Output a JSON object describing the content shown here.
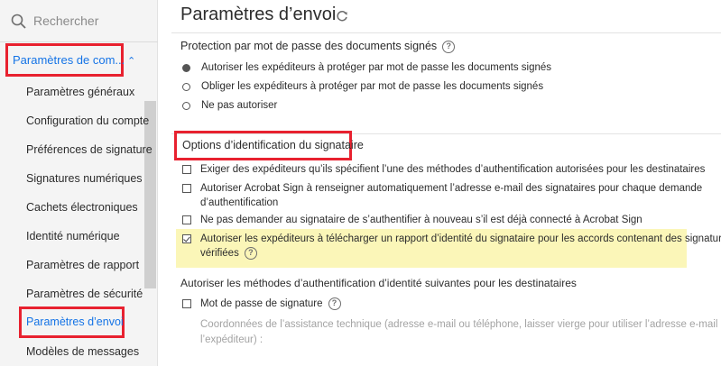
{
  "sidebar": {
    "search_placeholder": "Rechercher",
    "group_label": "Paramètres de com...",
    "items": [
      {
        "label": "Paramètres généraux"
      },
      {
        "label": "Configuration du compte"
      },
      {
        "label": "Préférences de signature"
      },
      {
        "label": "Signatures numériques"
      },
      {
        "label": "Cachets électroniques"
      },
      {
        "label": "Identité numérique"
      },
      {
        "label": "Paramètres de rapport"
      },
      {
        "label": "Paramètres de sécurité"
      },
      {
        "label": "Paramètres d’envoi"
      },
      {
        "label": "Modèles de messages"
      }
    ]
  },
  "main": {
    "title": "Paramètres d’envoi",
    "password_section": {
      "title": "Protection par mot de passe des documents signés",
      "options": [
        {
          "label": "Autoriser les expéditeurs à protéger par mot de passe les documents signés",
          "selected": true
        },
        {
          "label": "Obliger les expéditeurs à protéger par mot de passe les documents signés",
          "selected": false
        },
        {
          "label": "Ne pas autoriser",
          "selected": false
        }
      ]
    },
    "id_section": {
      "title": "Options d’identification du signataire",
      "options": [
        {
          "line1": "Exiger des expéditeurs qu’ils spécifient l’une des méthodes d’authentification autorisées pour les destinataires",
          "checked": false
        },
        {
          "line1": "Autoriser Acrobat Sign à renseigner automatiquement l’adresse e-mail des signataires pour chaque demande",
          "line2": "d’authentification",
          "checked": false
        },
        {
          "line1": "Ne pas demander au signataire de s’authentifier à nouveau s’il est déjà connecté à Acrobat Sign",
          "checked": false
        },
        {
          "line1": "Autoriser les expéditeurs à télécharger un rapport d’identité du signataire pour les accords contenant des signatures",
          "line2": "vérifiées",
          "checked": true
        }
      ]
    },
    "auth_section": {
      "title": "Autoriser les méthodes d’authentification d’identité suivantes pour les destinataires",
      "password_label": "Mot de passe de signature",
      "support_line1": "Coordonnées de l’assistance technique (adresse e-mail ou téléphone, laisser vierge pour utiliser l’adresse e-mail de",
      "support_line2": "l’expéditeur) :"
    }
  },
  "colors": {
    "accent": "#1473e6",
    "highlight_border": "#e8212f",
    "highlight_fill": "#fbf6b8"
  },
  "icons": {
    "search": "search-icon",
    "chevron": "chevron-up-icon",
    "refresh": "refresh-icon",
    "help": "help-circle-icon"
  }
}
